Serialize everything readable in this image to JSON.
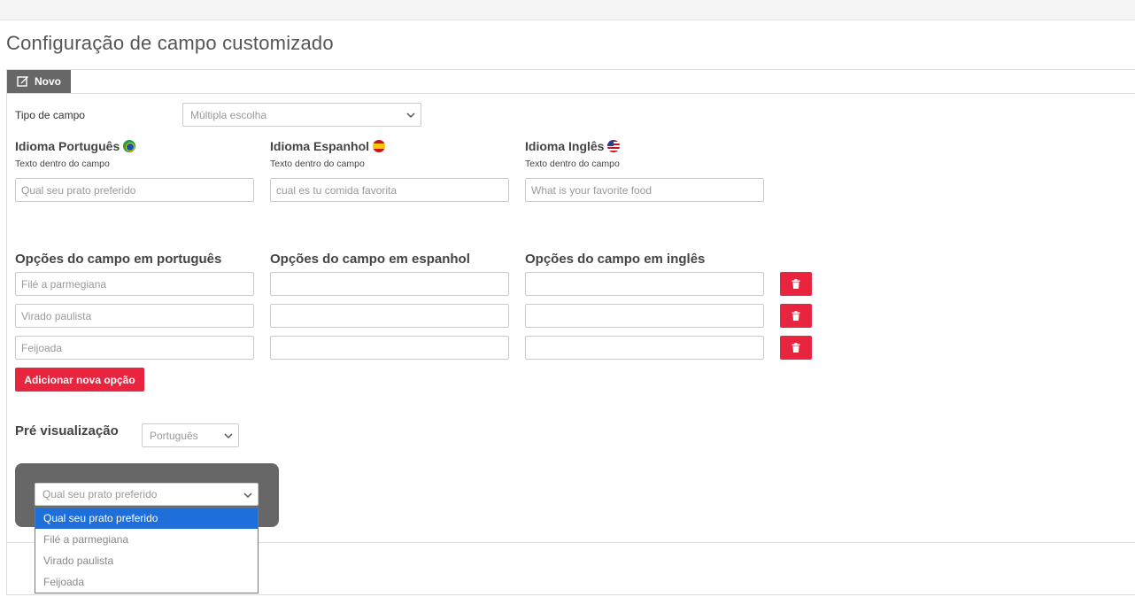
{
  "page": {
    "title": "Configuração de campo customizado"
  },
  "tab": {
    "label": "Novo",
    "icon": "edit-icon"
  },
  "field_type": {
    "label": "Tipo de campo",
    "value": "Múltipla escolha"
  },
  "languages": [
    {
      "title": "Idioma Português",
      "flag": "brazil-flag-icon",
      "sub": "Texto dentro do campo",
      "placeholder": "Qual seu prato preferido"
    },
    {
      "title": "Idioma Espanhol",
      "flag": "spain-flag-icon",
      "sub": "Texto dentro do campo",
      "placeholder": "cual es tu comida favorita"
    },
    {
      "title": "Idioma Inglês",
      "flag": "usa-flag-icon",
      "sub": "Texto dentro do campo",
      "placeholder": "What is your favorite food"
    }
  ],
  "options": {
    "headers": [
      "Opções do campo em português",
      "Opções do campo em espanhol",
      "Opções do campo em inglês"
    ],
    "rows": [
      {
        "pt": "Filé a parmegiana",
        "es": "",
        "en": ""
      },
      {
        "pt": "Virado paulista",
        "es": "",
        "en": ""
      },
      {
        "pt": "Feijoada",
        "es": "",
        "en": ""
      }
    ],
    "add_label": "Adicionar nova opção"
  },
  "preview": {
    "title": "Pré visualização",
    "language": "Português",
    "select_value": "Qual seu prato preferido",
    "dropdown_items": [
      "Qual seu prato preferido",
      "Filé a parmegiana",
      "Virado paulista",
      "Feijoada"
    ]
  },
  "colors": {
    "accent": "#e8243e",
    "tab": "#676767",
    "selected": "#1e6fd9"
  }
}
